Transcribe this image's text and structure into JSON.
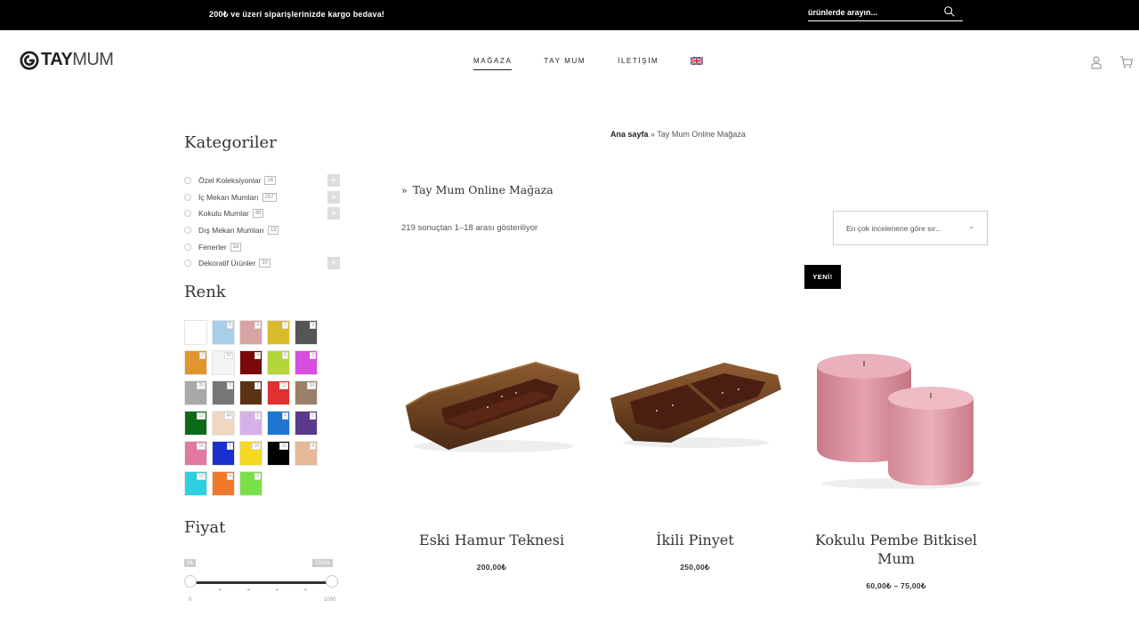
{
  "topbar": {
    "announcement": "200₺ ve üzeri siparişlerinizde kargo bedava!",
    "search_placeholder": "ürünlerde arayın..."
  },
  "header": {
    "logo_bold": "TAY",
    "logo_light": "MUM",
    "nav": [
      {
        "label": "MAĞAZA",
        "active": true
      },
      {
        "label": "TAY MUM",
        "active": false
      },
      {
        "label": "İLETİŞİM",
        "active": false
      }
    ]
  },
  "breadcrumb": {
    "home": "Ana sayfa",
    "separator": " » ",
    "current": "Tay Mum Online Mağaza"
  },
  "sidebar": {
    "categories_title": "Kategoriler",
    "categories": [
      {
        "label": "Özel Koleksiyonlar",
        "count": "16",
        "expandable": true
      },
      {
        "label": "İç Mekan Mumları",
        "count": "257",
        "expandable": true
      },
      {
        "label": "Kokulu Mumlar",
        "count": "48",
        "expandable": true
      },
      {
        "label": "Dış Mekan Mumları",
        "count": "13",
        "expandable": false
      },
      {
        "label": "Fenerler",
        "count": "18",
        "expandable": false
      },
      {
        "label": "Dekoratif Ürünler",
        "count": "30",
        "expandable": true
      }
    ],
    "color_title": "Renk",
    "colors": [
      {
        "hex": "#ffffff",
        "count": ""
      },
      {
        "hex": "#a8cfe8",
        "count": "5"
      },
      {
        "hex": "#d9a3a3",
        "count": "4"
      },
      {
        "hex": "#d9bb2c",
        "count": "1"
      },
      {
        "hex": "#555555",
        "count": "9"
      },
      {
        "hex": "#e0962e",
        "count": "2"
      },
      {
        "hex": "#f4f4f4",
        "count": "37"
      },
      {
        "hex": "#7a0a0a",
        "count": "4"
      },
      {
        "hex": "#b5d63a",
        "count": "6"
      },
      {
        "hex": "#d84fe0",
        "count": "3"
      },
      {
        "hex": "#a8a8a8",
        "count": "25"
      },
      {
        "hex": "#777777",
        "count": "9"
      },
      {
        "hex": "#5a3414",
        "count": "1"
      },
      {
        "hex": "#e03030",
        "count": "12"
      },
      {
        "hex": "#9a8068",
        "count": "34"
      },
      {
        "hex": "#0c6a18",
        "count": "13"
      },
      {
        "hex": "#f0d8c0",
        "count": "44"
      },
      {
        "hex": "#d6b0e8",
        "count": "5"
      },
      {
        "hex": "#1f76d0",
        "count": "4"
      },
      {
        "hex": "#5a3a8a",
        "count": "5"
      },
      {
        "hex": "#e07aa0",
        "count": "16"
      },
      {
        "hex": "#1a2fd0",
        "count": "1"
      },
      {
        "hex": "#f5d820",
        "count": "10"
      },
      {
        "hex": "#000000",
        "count": "16"
      },
      {
        "hex": "#e6b89a",
        "count": "4"
      },
      {
        "hex": "#2ed0e0",
        "count": "12"
      },
      {
        "hex": "#f07a2a",
        "count": "4"
      },
      {
        "hex": "#7ae04a",
        "count": "2"
      }
    ],
    "price_title": "Fiyat",
    "price_min_badge": "0₺",
    "price_max_badge": "1000₺",
    "price_min_label": "0",
    "price_max_label": "1000"
  },
  "main": {
    "shop_title": "Tay Mum Online Mağaza",
    "result_count": "219 sonuçtan 1–18 arası gösteriliyor",
    "sort_label": "En çok incelenene göre sır...",
    "badge_new": "YENİ!",
    "products": [
      {
        "name": "Eski Hamur Teknesi",
        "price": "200,00₺",
        "image": "wooden-trough-candle"
      },
      {
        "name": "İkili Pinyet",
        "price": "250,00₺",
        "image": "double-wooden-candle"
      },
      {
        "name": "Kokulu Pembe Bitkisel Mum",
        "price": "60,00₺ – 75,00₺",
        "image": "pink-pillar-candles"
      }
    ]
  },
  "colors": {
    "topbar_bg": "#000000",
    "text": "#333333",
    "accent": "#000000"
  }
}
